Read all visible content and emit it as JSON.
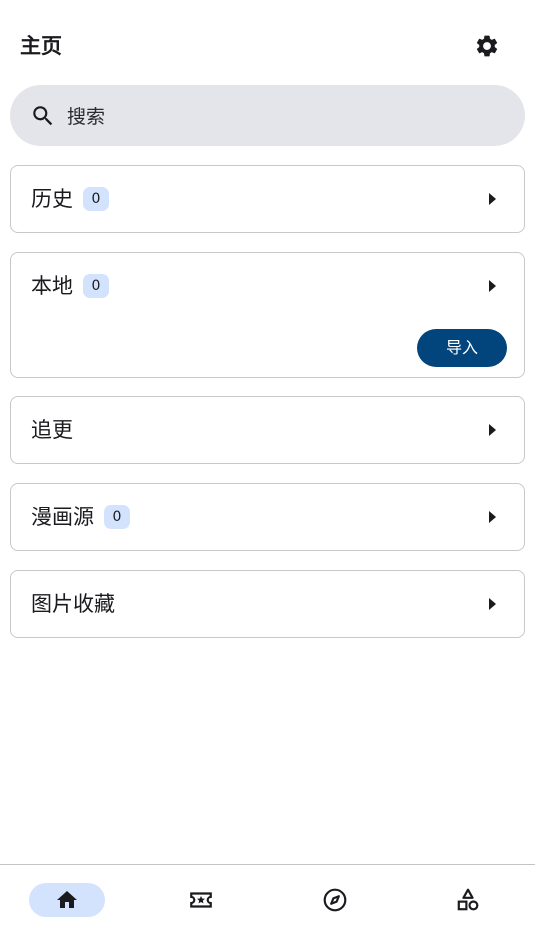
{
  "header": {
    "title": "主页",
    "settings_icon": "gear-icon"
  },
  "search": {
    "placeholder": "搜索",
    "icon": "search-icon"
  },
  "cards": {
    "history": {
      "label": "历史",
      "count": "0"
    },
    "local": {
      "label": "本地",
      "count": "0",
      "import_label": "导入"
    },
    "follow": {
      "label": "追更"
    },
    "sources": {
      "label": "漫画源",
      "count": "0"
    },
    "image_favorites": {
      "label": "图片收藏"
    }
  },
  "bottom_nav": {
    "items": [
      {
        "icon": "home-icon",
        "active": true
      },
      {
        "icon": "ticket-star-icon",
        "active": false
      },
      {
        "icon": "compass-icon",
        "active": false
      },
      {
        "icon": "categories-shapes-icon",
        "active": false
      }
    ],
    "active_color": "#d3e3fd"
  },
  "colors": {
    "search_bg": "#e4e5ea",
    "badge_bg": "#d3e3fd",
    "import_button_bg": "#02457c"
  }
}
